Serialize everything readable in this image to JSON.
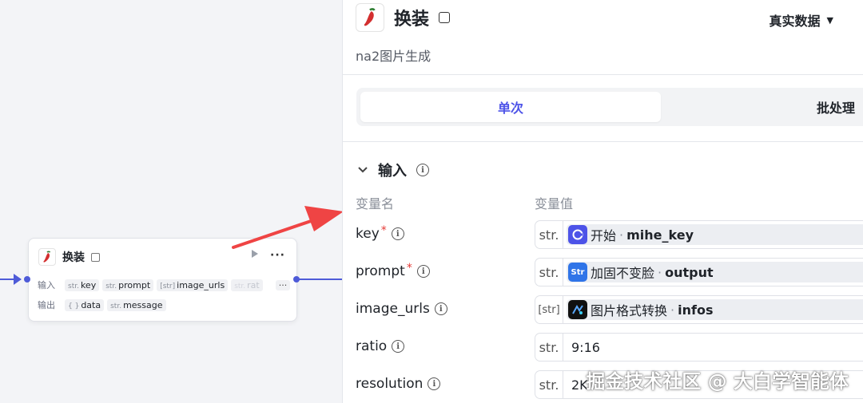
{
  "node": {
    "title": "换装",
    "input_label": "输入",
    "output_label": "输出",
    "inputs": [
      {
        "type": "str.",
        "name": "key"
      },
      {
        "type": "str.",
        "name": "prompt"
      },
      {
        "type": "[str]",
        "name": "image_urls"
      },
      {
        "type": "str.",
        "name": "rat"
      }
    ],
    "outputs": [
      {
        "type": "{ }",
        "name": "data"
      },
      {
        "type": "str.",
        "name": "message"
      }
    ],
    "more": "···"
  },
  "panel": {
    "title": "换装",
    "description": "na2图片生成",
    "data_mode": "真实数据",
    "tabs": [
      "单次",
      "批处理"
    ],
    "section_title": "输入",
    "col_name": "变量名",
    "col_value": "变量值",
    "rows": [
      {
        "name": "key",
        "required": "*",
        "type": "str.",
        "source_node": "开始",
        "sep": "·",
        "source_var": "mihe_key"
      },
      {
        "name": "prompt",
        "required": "*",
        "type": "str.",
        "source_node": "加固不变脸",
        "sep": "·",
        "source_var": "output"
      },
      {
        "name": "image_urls",
        "type": "[str]",
        "source_node": "图片格式转换",
        "sep": "·",
        "source_var": "infos"
      },
      {
        "name": "ratio",
        "type": "str.",
        "value": "9:16"
      },
      {
        "name": "resolution",
        "type": "str.",
        "value": "2K"
      }
    ]
  },
  "watermark": "掘金技术社区 @ 大白学智能体",
  "colors": {
    "accent": "#4d53e8",
    "arrow": "#ef4444",
    "required": "#e53935"
  }
}
